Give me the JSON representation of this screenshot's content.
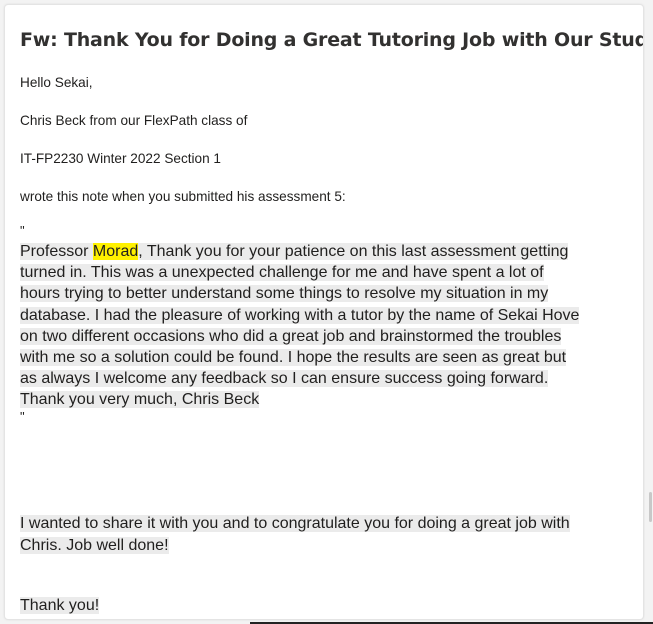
{
  "email": {
    "subject": "Fw: Thank You for Doing a Great Tutoring Job with Our Students",
    "greeting": "Hello Sekai,",
    "intro_line": "Chris Beck from our FlexPath class of",
    "course_line": "IT-FP2230 Winter 2022 Section 1",
    "wrote_line": "wrote this note when you submitted his assessment 5:",
    "open_quote": "\"",
    "close_quote": "\"",
    "note": {
      "prefix": "Professor ",
      "highlighted_name": "Morad",
      "line1_rest": ", Thank you for your patience on this last assessment getting",
      "line2": "turned in. This was a unexpected challenge for me and have spent a lot of",
      "line3": "hours trying to better understand some things to resolve my situation in my",
      "line4": "database. I had the pleasure of working with a tutor by the name of Sekai Hove",
      "line5": "on two different occasions who did a great job and brainstormed the troubles",
      "line6": "with me so a solution could be found.  I hope the results are seen as great but",
      "line7": "as always I welcome any feedback so I can ensure success going forward.",
      "line8": "Thank you very much, Chris Beck"
    },
    "share_line1": "I wanted to share it with you and to congratulate you for doing a great job with",
    "share_line2": "Chris. Job well done!",
    "closing": "Thank you!"
  },
  "colors": {
    "highlight_yellow": "#fff100",
    "quote_background": "#ebebeb",
    "text": "#201f1e"
  }
}
